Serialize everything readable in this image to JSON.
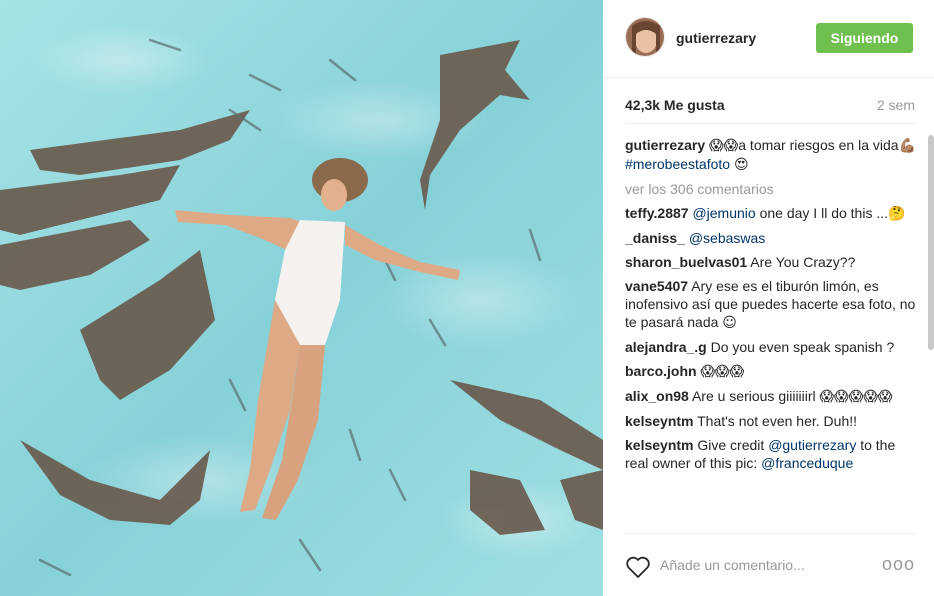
{
  "header": {
    "username": "gutierrezary",
    "follow_label": "Siguiendo"
  },
  "stats": {
    "likes": "42,3k Me gusta",
    "time": "2 sem"
  },
  "caption": {
    "username": "gutierrezary",
    "emoji_a": "😱😱",
    "text_a": "a tomar riesgos en la vida",
    "emoji_b": "💪🏽",
    "hashtag": "#merobeestafoto",
    "emoji_c": "😍"
  },
  "view_all": "ver los 306 comentarios",
  "comments": [
    {
      "user": "teffy.2887",
      "mention": "@jemunio",
      "text": " one day I ll do this ...",
      "emoji": "🤔"
    },
    {
      "user": "_daniss_",
      "mention": "@sebaswas",
      "text": "",
      "emoji": ""
    },
    {
      "user": "sharon_buelvas01",
      "mention": "",
      "text": "Are You Crazy??",
      "emoji": ""
    },
    {
      "user": "vane5407",
      "mention": "",
      "text": "Ary ese es el tiburón limón, es inofensivo así que puedes hacerte esa foto, no te pasará nada ",
      "emoji": "☺"
    },
    {
      "user": "alejandra_.g",
      "mention": "",
      "text": "Do you even speak spanish ?",
      "emoji": ""
    },
    {
      "user": "barco.john",
      "mention": "",
      "text": "",
      "emoji": "😱😱😱"
    },
    {
      "user": "alix_on98",
      "mention": "",
      "text": "Are u serious giiiiiiirl ",
      "emoji": "😱😱😱😱😱"
    },
    {
      "user": "kelseyntm",
      "mention": "",
      "text": "That's not even her. Duh!!",
      "emoji": ""
    },
    {
      "user": "kelseyntm",
      "mention": "",
      "text": "Give credit @gutierrezary to the real owner of this pic: @franceduque",
      "emoji": ""
    }
  ],
  "footer": {
    "placeholder": "Añade un comentario...",
    "options": "ooo"
  },
  "colors": {
    "follow_bg": "#70c050",
    "link": "#003569",
    "water": "#8fd6db"
  },
  "icons": {
    "like": "heart-outline-icon",
    "more": "more-options-icon"
  }
}
